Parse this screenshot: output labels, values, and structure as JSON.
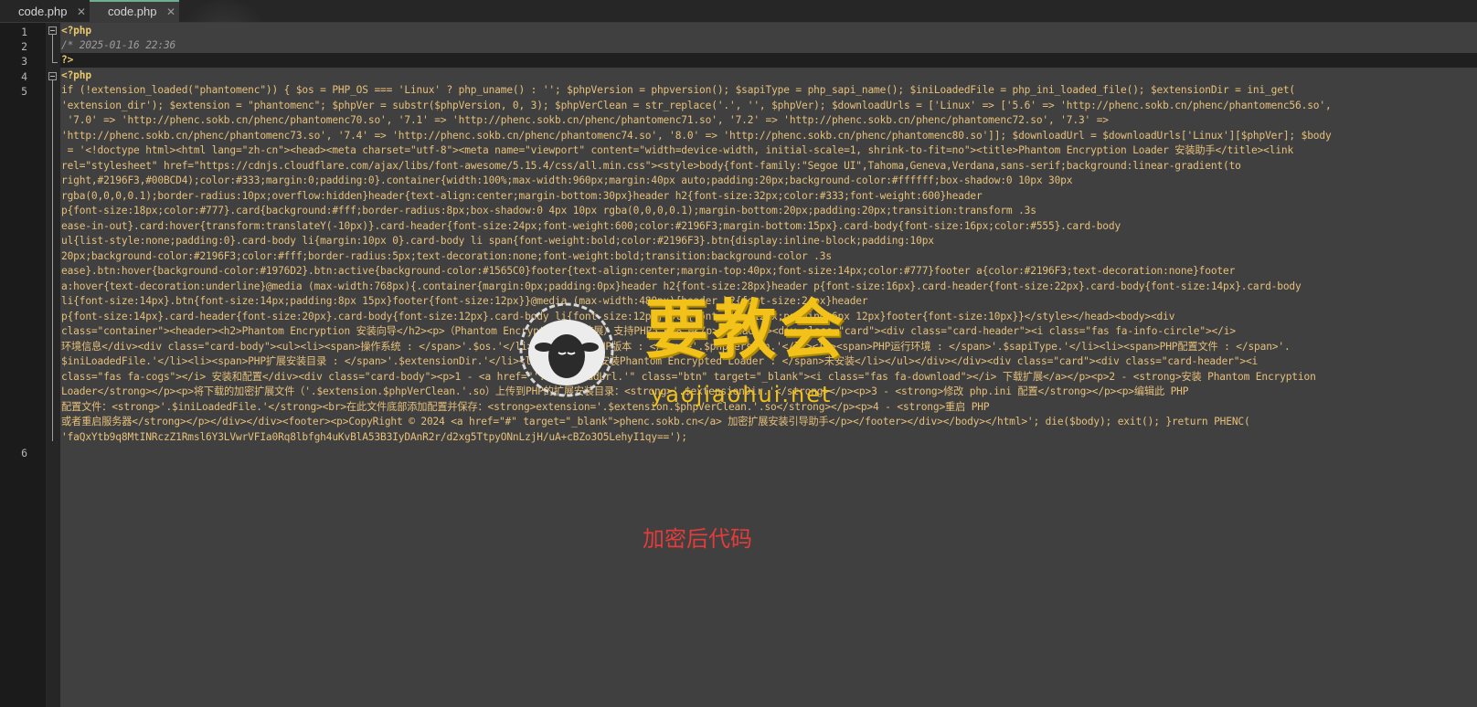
{
  "tabs": [
    {
      "label": "code.php",
      "close": "✕",
      "active": false
    },
    {
      "label": "code.php",
      "close": "✕",
      "active": true
    }
  ],
  "gutter": {
    "line_numbers": [
      "1",
      "2",
      "3",
      "4",
      "5",
      "6"
    ]
  },
  "code": {
    "line1": "<?php",
    "line2": "/* 2025-01-16 22:36",
    "line3": "?>",
    "line4": "<?php",
    "line5_wrapped": [
      "if (!extension_loaded(\"phantomenc\")) { $os = PHP_OS === 'Linux' ? php_uname() : ''; $phpVersion = phpversion(); $sapiType = php_sapi_name(); $iniLoadedFile = php_ini_loaded_file(); $extensionDir = ini_get(",
      "'extension_dir'); $extension = \"phantomenc\"; $phpVer = substr($phpVersion, 0, 3); $phpVerClean = str_replace('.', '', $phpVer); $downloadUrls = ['Linux' => ['5.6' => 'http://phenc.sokb.cn/phenc/phantomenc56.so',",
      " '7.0' => 'http://phenc.sokb.cn/phenc/phantomenc70.so', '7.1' => 'http://phenc.sokb.cn/phenc/phantomenc71.so', '7.2' => 'http://phenc.sokb.cn/phenc/phantomenc72.so', '7.3' =>",
      "'http://phenc.sokb.cn/phenc/phantomenc73.so', '7.4' => 'http://phenc.sokb.cn/phenc/phantomenc74.so', '8.0' => 'http://phenc.sokb.cn/phenc/phantomenc80.so']]; $downloadUrl = $downloadUrls['Linux'][$phpVer]; $body",
      " = '<!doctype html><html lang=\"zh-cn\"><head><meta charset=\"utf-8\"><meta name=\"viewport\" content=\"width=device-width, initial-scale=1, shrink-to-fit=no\"><title>Phantom Encryption Loader 安装助手</title><link",
      "rel=\"stylesheet\" href=\"https://cdnjs.cloudflare.com/ajax/libs/font-awesome/5.15.4/css/all.min.css\"><style>body{font-family:\"Segoe UI\",Tahoma,Geneva,Verdana,sans-serif;background:linear-gradient(to",
      "right,#2196F3,#00BCD4);color:#333;margin:0;padding:0}.container{width:100%;max-width:960px;margin:40px auto;padding:20px;background-color:#ffffff;box-shadow:0 10px 30px",
      "rgba(0,0,0,0.1);border-radius:10px;overflow:hidden}header{text-align:center;margin-bottom:30px}header h2{font-size:32px;color:#333;font-weight:600}header",
      "p{font-size:18px;color:#777}.card{background:#fff;border-radius:8px;box-shadow:0 4px 10px rgba(0,0,0,0.1);margin-bottom:20px;padding:20px;transition:transform .3s",
      "ease-in-out}.card:hover{transform:translateY(-10px)}.card-header{font-size:24px;font-weight:600;color:#2196F3;margin-bottom:15px}.card-body{font-size:16px;color:#555}.card-body",
      "ul{list-style:none;padding:0}.card-body li{margin:10px 0}.card-body li span{font-weight:bold;color:#2196F3}.btn{display:inline-block;padding:10px",
      "20px;background-color:#2196F3;color:#fff;border-radius:5px;text-decoration:none;font-weight:bold;transition:background-color .3s",
      "ease}.btn:hover{background-color:#1976D2}.btn:active{background-color:#1565C0}footer{text-align:center;margin-top:40px;font-size:14px;color:#777}footer a{color:#2196F3;text-decoration:none}footer",
      "a:hover{text-decoration:underline}@media (max-width:768px){.container{margin:0px;padding:0px}header h2{font-size:28px}header p{font-size:16px}.card-header{font-size:22px}.card-body{font-size:14px}.card-body",
      "li{font-size:14px}.btn{font-size:14px;padding:8px 15px}footer{font-size:12px}}@media (max-width:480px){header h2{font-size:24px}header",
      "p{font-size:14px}.card-header{font-size:20px}.card-body{font-size:12px}.card-body li{font-size:12px}.btn{font-size:12px;padding:6px 12px}footer{font-size:10px}}</style></head><body><div",
      "class=\"container\"><header><h2>Phantom Encryption 安装向导</h2><p>（Phantom Encryption加密扩展）支持PHP5.6-8.0</p></header><div class=\"card\"><div class=\"card-header\"><i class=\"fas fa-info-circle\"></i>",
      "环境信息</div><div class=\"card-body\"><ul><li><span>操作系统 : </span>'.$os.'</li><li><span>PHP版本 : </span>'.$phpVersion.'</li><li><span>PHP运行环境 : </span>'.$sapiType.'</li><li><span>PHP配置文件 : </span>'.",
      "$iniLoadedFile.'</li><li><span>PHP扩展安装目录 : </span>'.$extensionDir.'</li><li><span>是否安装Phantom Encrypted Loader : </span>未安装</li></ul></div></div><div class=\"card\"><div class=\"card-header\"><i",
      "class=\"fas fa-cogs\"></i> 安装和配置</div><div class=\"card-body\"><p>1 - <a href=\"'.$downloadUrl.'\" class=\"btn\" target=\"_blank\"><i class=\"fas fa-download\"></i> 下载扩展</a></p><p>2 - <strong>安装 Phantom Encryption",
      "Loader</strong></p><p>将下载的加密扩展文件（'.$extension.$phpVerClean.'.so）上传到PHP的扩展安装目录：<strong>'.$extensionDir.'</strong></p><p>3 - <strong>修改 php.ini 配置</strong></p><p>编辑此 PHP",
      "配置文件：<strong>'.$iniLoadedFile.'</strong><br>在此文件底部添加配置并保存：<strong>extension='.$extension.$phpVerClean.'.so</strong></p><p>4 - <strong>重启 PHP",
      "或者重启服务器</strong></p></div></div><footer><p>CopyRight © 2024 <a href=\"#\" target=\"_blank\">phenc.sokb.cn</a> 加密扩展安装引导助手</p></footer></div></body></html>'; die($body); exit(); }return PHENC(",
      "'faQxYtb9q8MtINRczZ1Rmsl6Y3LVwrVFIa0Rq8lbfgh4uKvBlA53B3IyDAnR2r/d2xg5TtpyONnLzjH/uA+cBZo3O5LehyI1qy==');"
    ]
  },
  "watermark": {
    "title": "要教会",
    "subtitle": "yaojiaohui.net"
  },
  "caption": "加密后代码"
}
